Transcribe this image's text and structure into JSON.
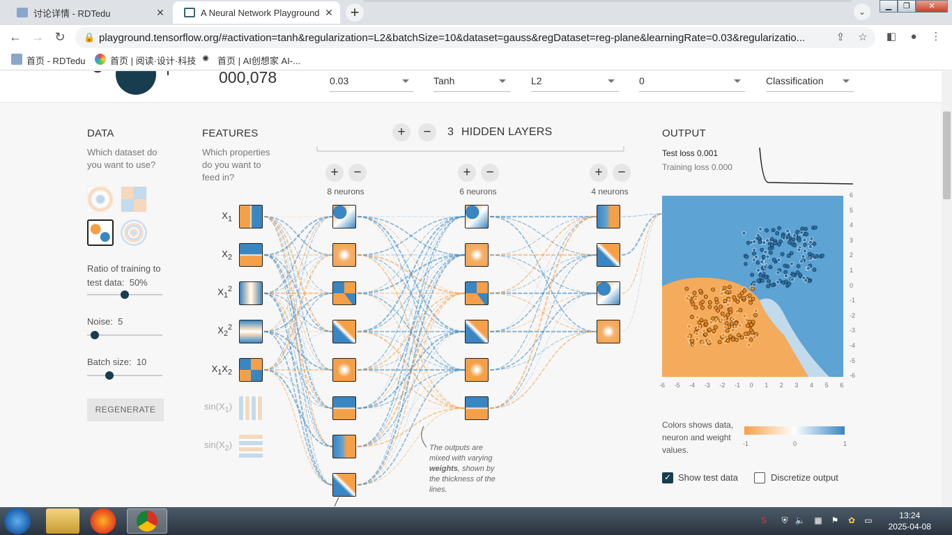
{
  "tabs": [
    {
      "title": "讨论详情 - RDTedu"
    },
    {
      "title": "A Neural Network Playground"
    }
  ],
  "browser": {
    "url": "playground.tensorflow.org/#activation=tanh&regularization=L2&batchSize=10&dataset=gauss&regDataset=reg-plane&learningRate=0.03&regularizatio..."
  },
  "bookmarks": [
    {
      "label": "首页 - RDTedu"
    },
    {
      "label": "首页 | 阅读·设计·科技"
    },
    {
      "label": "首页 | AI创想家 AI-..."
    }
  ],
  "controls": {
    "epoch": "000,078",
    "learning_rate": "0.03",
    "activation": "Tanh",
    "regularization": "L2",
    "reg_rate": "0",
    "problem_type": "Classification"
  },
  "data_panel": {
    "title": "DATA",
    "subtitle": "Which dataset do you want to use?",
    "ratio_label": "Ratio of training to test data:",
    "ratio_value": "50%",
    "ratio_level": 0.5,
    "noise_label": "Noise:",
    "noise_value": "5",
    "noise_level": 0.1,
    "batch_label": "Batch size:",
    "batch_value": "10",
    "batch_level": 0.3,
    "regenerate": "REGENERATE"
  },
  "features": {
    "title": "FEATURES",
    "subtitle": "Which properties do you want to feed in?"
  },
  "network": {
    "hidden_layers_count": "3",
    "hidden_layers_label": "HIDDEN LAYERS",
    "layers": [
      {
        "neurons": "8 neurons"
      },
      {
        "neurons": "6 neurons"
      },
      {
        "neurons": "4 neurons"
      }
    ],
    "annotation_1": "The outputs are mixed with varying",
    "annotation_bold": "weights",
    "annotation_2": ", shown by the thickness of the lines."
  },
  "output": {
    "title": "OUTPUT",
    "test_loss": "Test loss 0.001",
    "training_loss": "Training loss 0.000",
    "y_ticks": [
      "6",
      "5",
      "4",
      "3",
      "2",
      "1",
      "0",
      "-1",
      "-2",
      "-3",
      "-4",
      "-5",
      "-6"
    ],
    "x_ticks": [
      "-6",
      "-5",
      "-4",
      "-3",
      "-2",
      "-1",
      "0",
      "1",
      "2",
      "3",
      "4",
      "5",
      "6"
    ],
    "legend_text": "Colors shows data, neuron and weight values.",
    "legend_min": "-1",
    "legend_mid": "0",
    "legend_max": "1",
    "show_test_data": "Show test data",
    "discretize": "Discretize output"
  },
  "colors": {
    "orange": "#f5a048",
    "blue": "#3a86c2",
    "dark": "#183d4e"
  },
  "clock": {
    "time": "13:24",
    "date": "2025-04-08"
  }
}
